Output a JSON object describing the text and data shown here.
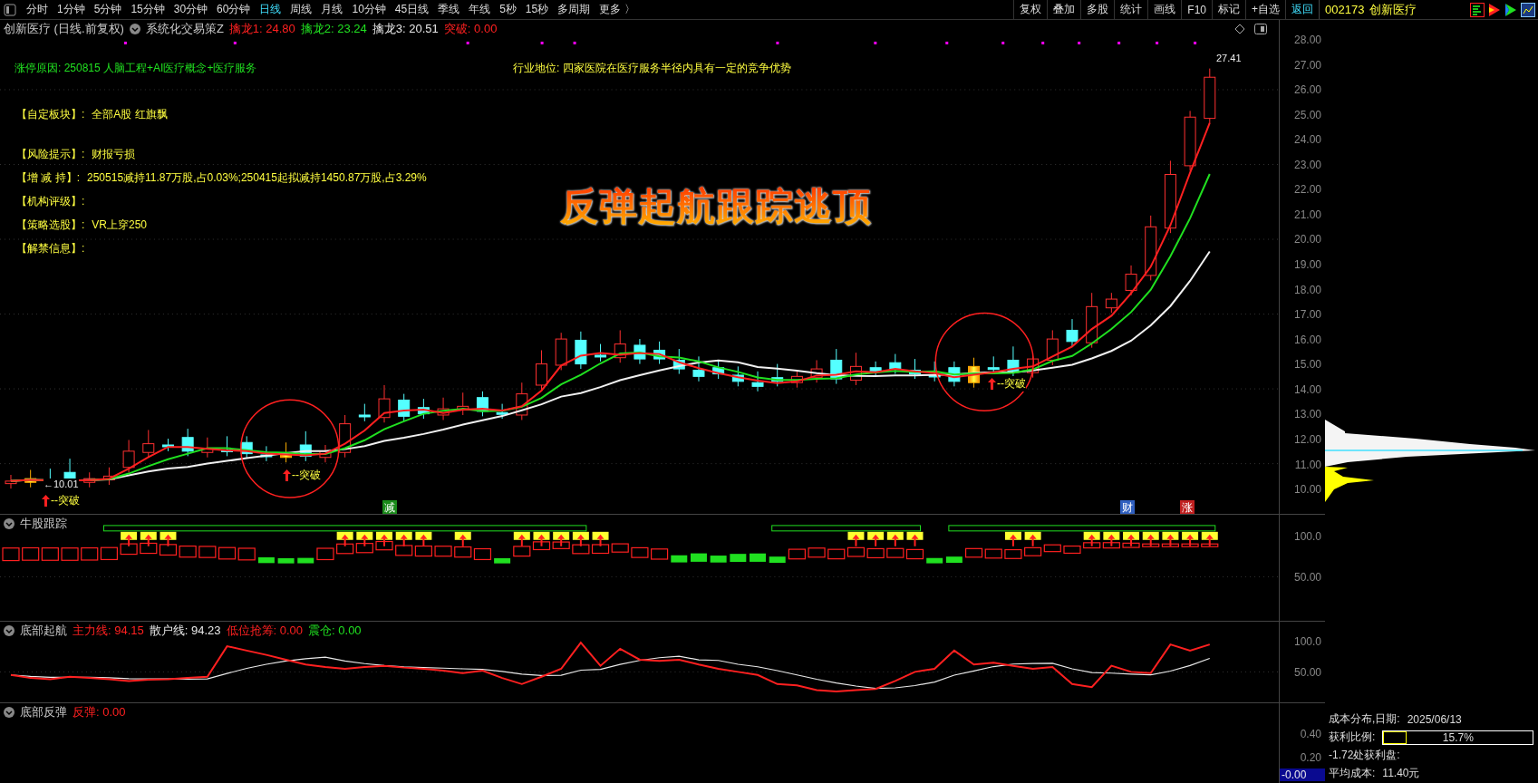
{
  "toolbar": {
    "periods": [
      {
        "label": "分时",
        "selected": false
      },
      {
        "label": "1分钟",
        "selected": false
      },
      {
        "label": "5分钟",
        "selected": false
      },
      {
        "label": "15分钟",
        "selected": false
      },
      {
        "label": "30分钟",
        "selected": false
      },
      {
        "label": "60分钟",
        "selected": false
      },
      {
        "label": "日线",
        "selected": true
      },
      {
        "label": "周线",
        "selected": false
      },
      {
        "label": "月线",
        "selected": false
      },
      {
        "label": "10分钟",
        "selected": false
      },
      {
        "label": "45日线",
        "selected": false
      },
      {
        "label": "季线",
        "selected": false
      },
      {
        "label": "年线",
        "selected": false
      },
      {
        "label": "5秒",
        "selected": false
      },
      {
        "label": "15秒",
        "selected": false
      },
      {
        "label": "多周期",
        "selected": false
      },
      {
        "label": "更多 〉",
        "selected": false
      }
    ],
    "tools": [
      {
        "label": "复权",
        "kind": "tool"
      },
      {
        "label": "叠加",
        "kind": "tool"
      },
      {
        "label": "多股",
        "kind": "tool"
      },
      {
        "label": "统计",
        "kind": "tool"
      },
      {
        "label": "画线",
        "kind": "tool"
      },
      {
        "label": "F10",
        "kind": "tool"
      },
      {
        "label": "标记",
        "kind": "tool"
      },
      {
        "label": "+自选",
        "kind": "tool"
      },
      {
        "label": "返回",
        "kind": "link"
      }
    ],
    "stock": {
      "code": "002173",
      "name": "创新医疗"
    }
  },
  "main_chart": {
    "title": "创新医疗 (日线.前复权)",
    "indicator": "系统化交易策Z",
    "values": [
      {
        "label": "擒龙1:",
        "value": "24.80",
        "color": "#ff2020"
      },
      {
        "label": "擒龙2:",
        "value": "23.24",
        "color": "#20e020"
      },
      {
        "label": "擒龙3:",
        "value": "20.51",
        "color": "#e8e8e8"
      },
      {
        "label": "突破:",
        "value": "0.00",
        "color": "#ff2020"
      }
    ],
    "limit_up_reason": "涨停原因: 250815 人脑工程+AI医疗概念+医疗服务",
    "industry_position": "行业地位: 四家医院在医疗服务半径内具有一定的竞争优势",
    "info_rows": [
      {
        "label": "【自定板块】:",
        "value": "全部A股 红旗飘"
      },
      {
        "label": "【风险提示】:",
        "value": "财报亏损"
      },
      {
        "label": "【增 减 持】:",
        "value": "250515减持11.87万股,占0.03%;250415起拟减持1450.87万股,占3.29%"
      },
      {
        "label": "【机构评级】:",
        "value": ""
      },
      {
        "label": "【策略选股】:",
        "value": "VR上穿250"
      },
      {
        "label": "【解禁信息】:",
        "value": ""
      }
    ],
    "headline": "反弹起航跟踪逃顶",
    "high_label": "27.41",
    "low_label": "←10.01",
    "breakouts": [
      {
        "label": "--突破"
      },
      {
        "label": "--突破"
      },
      {
        "label": "--突破"
      }
    ],
    "event_markers": [
      {
        "label": "减",
        "color": "#1a8a1a"
      },
      {
        "label": "财",
        "color": "#3060c0"
      },
      {
        "label": "涨",
        "color": "#c02020"
      }
    ],
    "price_ticks": [
      "28.00",
      "27.00",
      "26.00",
      "25.00",
      "24.00",
      "23.00",
      "22.00",
      "21.00",
      "20.00",
      "19.00",
      "18.00",
      "17.00",
      "16.00",
      "15.00",
      "14.00",
      "13.00",
      "12.00",
      "11.00",
      "10.00"
    ]
  },
  "bull_tracking": {
    "title": "牛股跟踪",
    "ticks": [
      "100.0",
      "50.00"
    ]
  },
  "bottom_launch": {
    "title": "底部起航",
    "values": [
      {
        "label": "主力线:",
        "value": "94.15",
        "color": "#ff2020"
      },
      {
        "label": "散户线:",
        "value": "94.23",
        "color": "#e8e8e8"
      },
      {
        "label": "低位抢筹:",
        "value": "0.00",
        "color": "#ff2020"
      },
      {
        "label": "震仓:",
        "value": "0.00",
        "color": "#20e020"
      }
    ],
    "ticks": [
      "100.0",
      "50.00"
    ]
  },
  "bottom_rebound": {
    "title": "底部反弹",
    "values": [
      {
        "label": "反弹:",
        "value": "0.00",
        "color": "#ff2020"
      }
    ],
    "ticks": [
      "0.40",
      "0.20"
    ],
    "current": "-0.00"
  },
  "cost_distribution": {
    "date_label": "成本分布,日期:",
    "date": "2025/06/13",
    "profit_label": "获利比例:",
    "profit_ratio": {
      "level": 0.157,
      "reading": "15.7%"
    },
    "profit_line": "-1.72处获利盘:",
    "avg_label": "平均成本:",
    "avg_value": "11.40元"
  }
}
